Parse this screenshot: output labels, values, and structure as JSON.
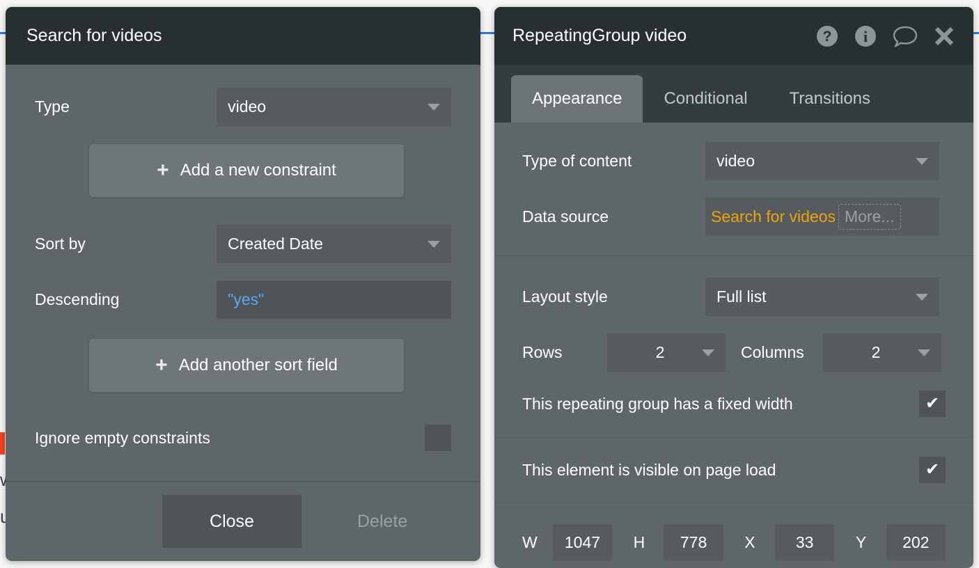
{
  "canvas": {
    "blue_guide_color": "#2a7ae2",
    "red_marker_color": "#f04523",
    "stray_letter_1": "w",
    "stray_letter_2": "u"
  },
  "search_panel": {
    "title": "Search for videos",
    "type_row": {
      "label": "Type",
      "value": "video"
    },
    "add_constraint_label": "Add a new constraint",
    "sort_by_row": {
      "label": "Sort by",
      "value": "Created Date"
    },
    "descending_row": {
      "label": "Descending",
      "value": "\"yes\""
    },
    "add_sort_field_label": "Add another sort field",
    "ignore_empty_row": {
      "label": "Ignore empty constraints",
      "checked": false,
      "check_glyph": ""
    },
    "footer": {
      "close_label": "Close",
      "delete_label": "Delete"
    }
  },
  "element_panel": {
    "title": "RepeatingGroup video",
    "header_icons": [
      {
        "name": "help-icon",
        "title": "Help"
      },
      {
        "name": "info-icon",
        "title": "Info"
      },
      {
        "name": "comment-icon",
        "title": "Comment"
      },
      {
        "name": "close-icon",
        "title": "Close"
      }
    ],
    "tabs": [
      {
        "label": "Appearance",
        "active": true
      },
      {
        "label": "Conditional",
        "active": false
      },
      {
        "label": "Transitions",
        "active": false
      }
    ],
    "type_of_content": {
      "label": "Type of content",
      "value": "video"
    },
    "data_source": {
      "label": "Data source",
      "value": "Search for videos",
      "more_label": "More...",
      "value_color": "#f0a30a"
    },
    "layout_style": {
      "label": "Layout style",
      "value": "Full list"
    },
    "rows": {
      "label": "Rows",
      "value": "2"
    },
    "columns": {
      "label": "Columns",
      "value": "2"
    },
    "fixed_width": {
      "label": "This repeating group has a fixed width",
      "checked": true,
      "check_glyph": "✔"
    },
    "visible_on_load": {
      "label": "This element is visible on page load",
      "checked": true,
      "check_glyph": "✔"
    },
    "geometry": {
      "w_label": "W",
      "w_value": "1047",
      "h_label": "H",
      "h_value": "778",
      "x_label": "X",
      "x_value": "33",
      "y_label": "Y",
      "y_value": "202"
    }
  }
}
